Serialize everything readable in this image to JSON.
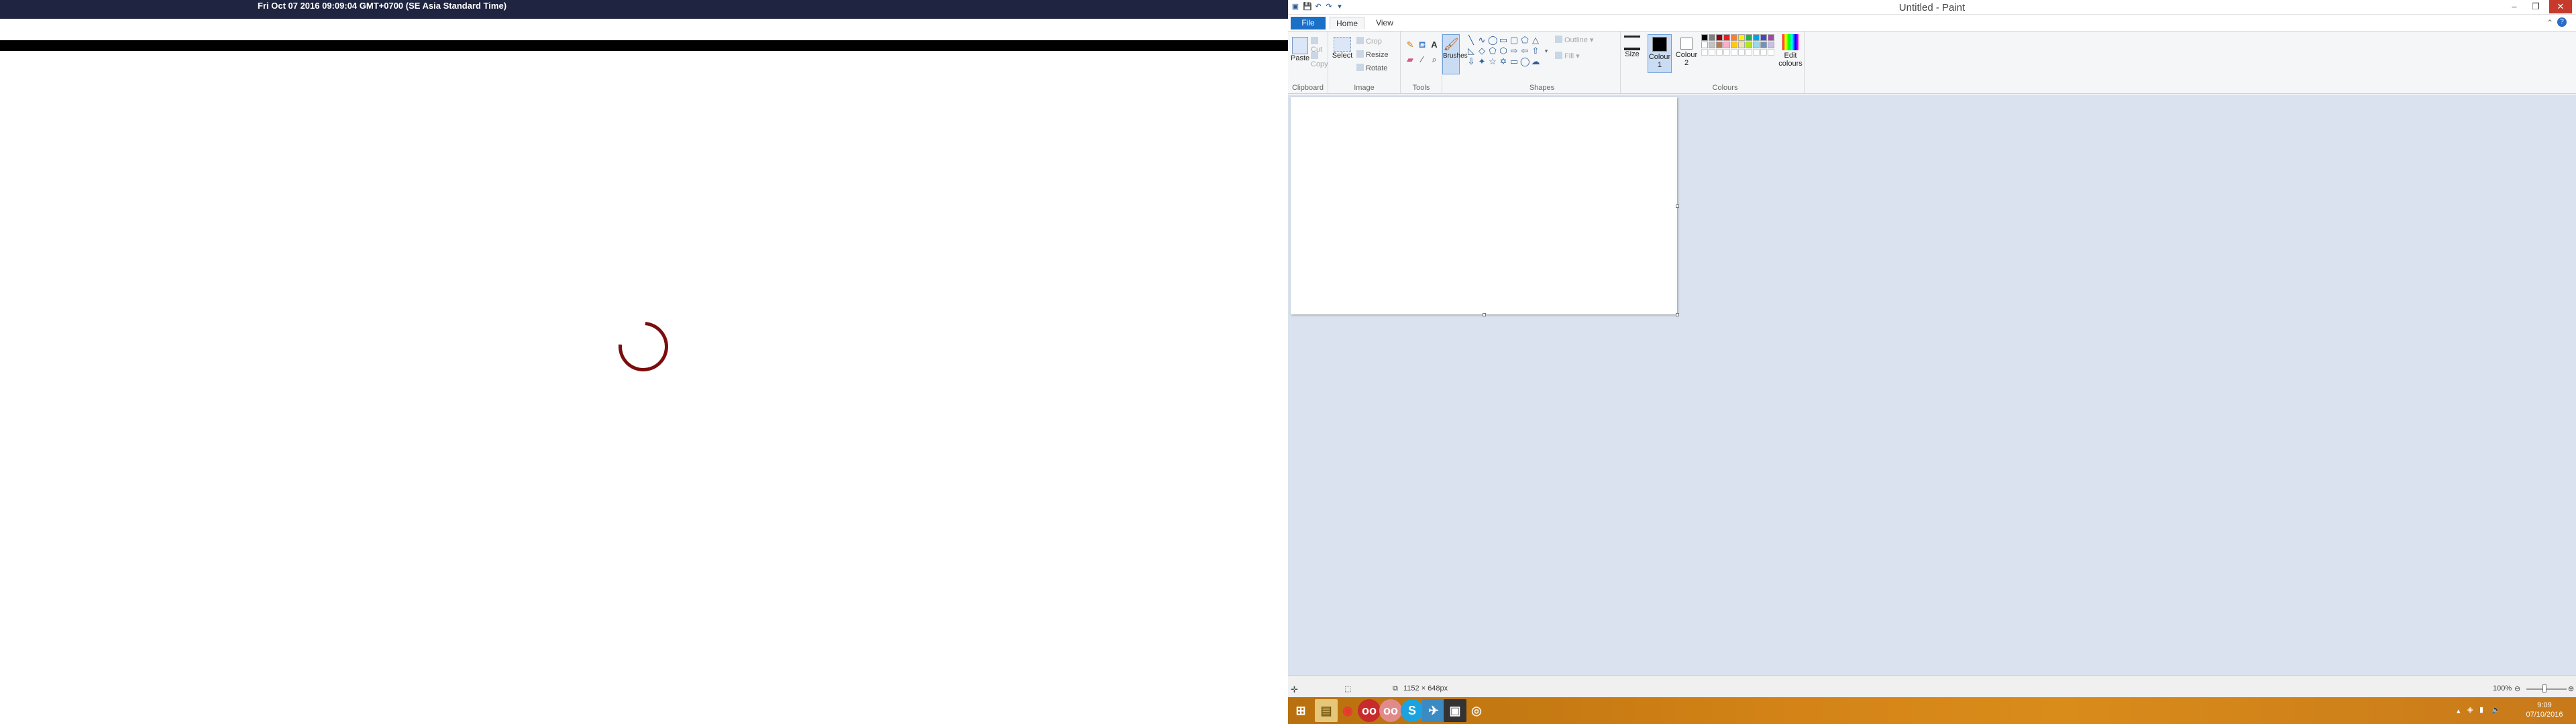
{
  "left_window": {
    "timestamp": "Fri Oct 07 2016 09:09:04 GMT+0700 (SE Asia Standard Time)"
  },
  "paint": {
    "title": "Untitled - Paint",
    "tabs": {
      "file": "File",
      "home": "Home",
      "view": "View"
    },
    "clipboard": {
      "paste": "Paste",
      "cut": "Cut",
      "copy": "Copy",
      "group": "Clipboard"
    },
    "image": {
      "select": "Select",
      "crop": "Crop",
      "resize": "Resize",
      "rotate": "Rotate",
      "group": "Image"
    },
    "tools": {
      "group": "Tools",
      "brushes": "Brushes"
    },
    "shapes": {
      "outline": "Outline",
      "fill": "Fill",
      "group": "Shapes"
    },
    "size": {
      "label": "Size"
    },
    "colours": {
      "colour1": "Colour 1",
      "colour2": "Colour 2",
      "edit": "Edit colours",
      "group": "Colours",
      "palette_row1": [
        "#000000",
        "#7f7f7f",
        "#880015",
        "#ed1c24",
        "#ff7f27",
        "#fff200",
        "#22b14c",
        "#00a2e8",
        "#3f48cc",
        "#a349a4"
      ],
      "palette_row2": [
        "#ffffff",
        "#c3c3c3",
        "#b97a57",
        "#ffaec9",
        "#ffc90e",
        "#efe4b0",
        "#b5e61d",
        "#99d9ea",
        "#7092be",
        "#c8bfe7"
      ]
    },
    "status": {
      "dimensions": "1152 × 648px",
      "zoom": "100%"
    }
  },
  "taskbar": {
    "time": "9:09",
    "date": "07/10/2016"
  }
}
